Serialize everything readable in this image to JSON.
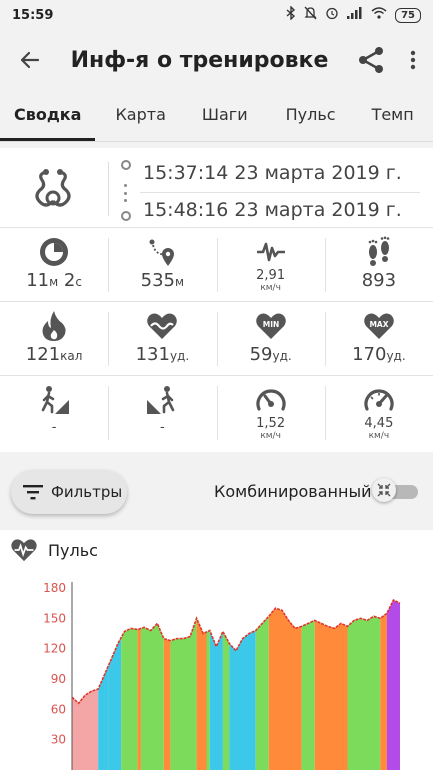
{
  "status_bar": {
    "time": "15:59",
    "battery": "75"
  },
  "header": {
    "title": "Инф-я о тренировке"
  },
  "tabs": [
    {
      "label": "Сводка",
      "active": true
    },
    {
      "label": "Карта"
    },
    {
      "label": "Шаги"
    },
    {
      "label": "Пульс"
    },
    {
      "label": "Темп"
    }
  ],
  "summary": {
    "start": "15:37:14 23 марта 2019 г.",
    "end": "15:48:16 23 марта 2019 г.",
    "stats_row1": [
      {
        "icon": "stopwatch-icon",
        "num": "11",
        "unit": "м",
        "num2": " 2",
        "unit2": "с"
      },
      {
        "icon": "route-icon",
        "num": "535",
        "unit": "м"
      },
      {
        "icon": "speed-wave-icon",
        "num": "2,91",
        "unit": "км/ч"
      },
      {
        "icon": "footprints-icon",
        "num": "893",
        "unit": ""
      }
    ],
    "stats_row2": [
      {
        "icon": "flame-icon",
        "num": "121",
        "unit": "кал"
      },
      {
        "icon": "heart-wave-icon",
        "num": "131",
        "unit": "уд."
      },
      {
        "icon": "heart-min-icon",
        "badge": "MIN",
        "num": "59",
        "unit": "уд."
      },
      {
        "icon": "heart-max-icon",
        "badge": "MAX",
        "num": "170",
        "unit": "уд."
      }
    ],
    "stats_row3": [
      {
        "icon": "walk-uphill-icon",
        "num": "-",
        "unit": ""
      },
      {
        "icon": "walk-downhill-icon",
        "num": "-",
        "unit": ""
      },
      {
        "icon": "speedometer-low-icon",
        "num": "1,52",
        "unit": "км/ч"
      },
      {
        "icon": "speedometer-high-icon",
        "num": "4,45",
        "unit": "км/ч"
      }
    ]
  },
  "controls": {
    "filters_label": "Фильтры",
    "combined_label": "Комбинированный",
    "combined_on": false
  },
  "chart_section": {
    "title": "Пульс"
  },
  "colors": {
    "heart": "#555555",
    "axis_red": "#d9534f",
    "line": "#e0352b"
  },
  "chart_data": {
    "type": "area",
    "title": "Пульс",
    "ylim": [
      0,
      180
    ],
    "yticks": [
      30,
      60,
      90,
      120,
      150,
      180
    ],
    "x": [
      0,
      2,
      4,
      6,
      8,
      10,
      12,
      14,
      16,
      18,
      20,
      22,
      24,
      26,
      28,
      30,
      32,
      34,
      36,
      38,
      40,
      42,
      44,
      46,
      48,
      50,
      52,
      54,
      56,
      58,
      60,
      62,
      64,
      66,
      68,
      70,
      72,
      74,
      76,
      78,
      80,
      82,
      84,
      86,
      88,
      90,
      92,
      94,
      96,
      98,
      100
    ],
    "y": [
      72,
      66,
      74,
      78,
      80,
      95,
      110,
      125,
      137,
      140,
      139,
      141,
      138,
      145,
      130,
      128,
      130,
      130,
      132,
      150,
      135,
      138,
      122,
      137,
      125,
      118,
      130,
      135,
      138,
      145,
      152,
      160,
      158,
      148,
      140,
      142,
      145,
      148,
      145,
      142,
      140,
      145,
      142,
      148,
      150,
      148,
      152,
      150,
      155,
      168,
      165
    ],
    "zones": [
      {
        "from": 0,
        "to": 8,
        "color": "#f4a6a6"
      },
      {
        "from": 8,
        "to": 11,
        "color": "#3cc8e8"
      },
      {
        "from": 11,
        "to": 15,
        "color": "#3cc8e8"
      },
      {
        "from": 15,
        "to": 20,
        "color": "#7cdb5a"
      },
      {
        "from": 20,
        "to": 21,
        "color": "#ff8a3a"
      },
      {
        "from": 21,
        "to": 28,
        "color": "#7cdb5a"
      },
      {
        "from": 28,
        "to": 30,
        "color": "#ff8a3a"
      },
      {
        "from": 30,
        "to": 38,
        "color": "#7cdb5a"
      },
      {
        "from": 38,
        "to": 41,
        "color": "#ff8a3a"
      },
      {
        "from": 41,
        "to": 42,
        "color": "#7cdb5a"
      },
      {
        "from": 42,
        "to": 46,
        "color": "#3cc8e8"
      },
      {
        "from": 46,
        "to": 48,
        "color": "#7cdb5a"
      },
      {
        "from": 48,
        "to": 56,
        "color": "#3cc8e8"
      },
      {
        "from": 56,
        "to": 60,
        "color": "#7cdb5a"
      },
      {
        "from": 60,
        "to": 70,
        "color": "#ff8a3a"
      },
      {
        "from": 70,
        "to": 74,
        "color": "#7cdb5a"
      },
      {
        "from": 74,
        "to": 84,
        "color": "#ff8a3a"
      },
      {
        "from": 84,
        "to": 94,
        "color": "#7cdb5a"
      },
      {
        "from": 94,
        "to": 96,
        "color": "#ff8a3a"
      },
      {
        "from": 96,
        "to": 100,
        "color": "#b24be8"
      }
    ]
  }
}
